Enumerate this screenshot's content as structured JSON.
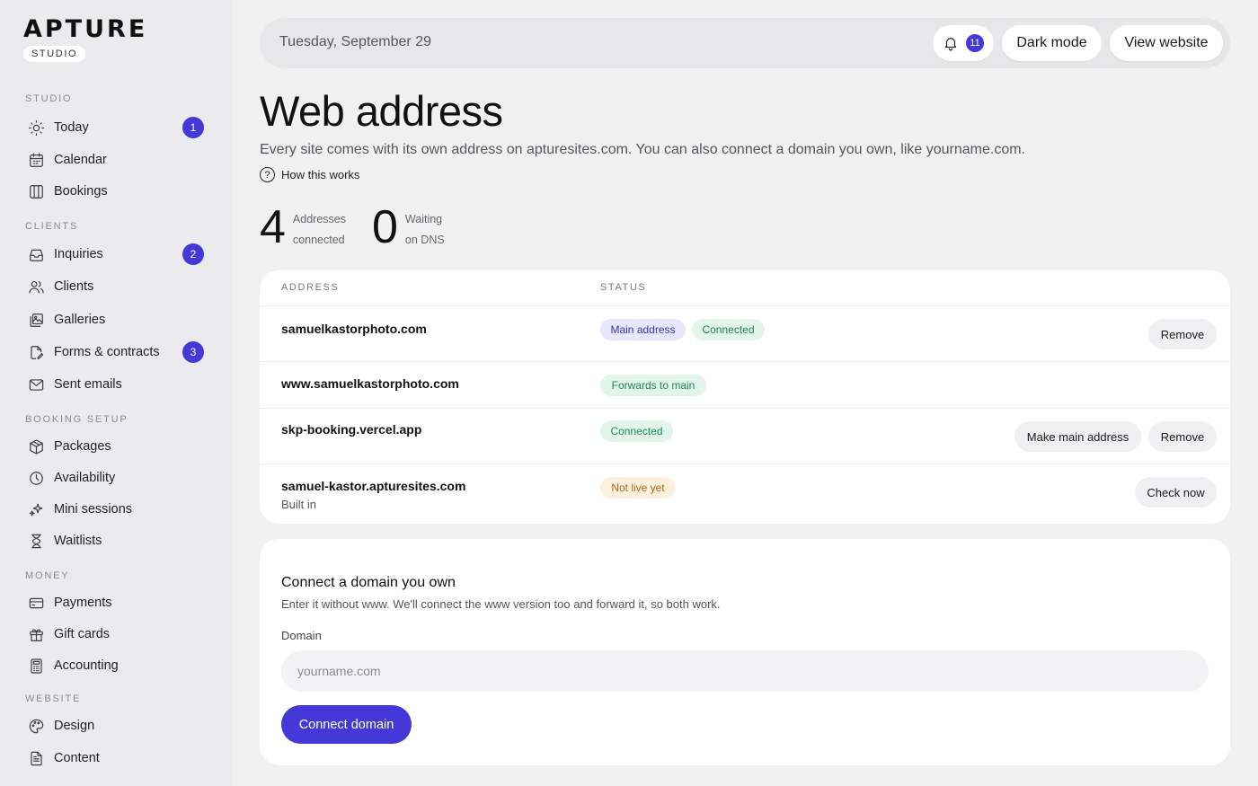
{
  "brand": {
    "logo_text": "APTURE",
    "sub_label": "STUDIO"
  },
  "sidebar": {
    "sections": [
      {
        "id": "studio",
        "label": "STUDIO"
      },
      {
        "id": "clients",
        "label": "CLIENTS"
      },
      {
        "id": "booking",
        "label": "BOOKING SETUP"
      },
      {
        "id": "money",
        "label": "MONEY"
      },
      {
        "id": "website",
        "label": "WEBSITE"
      }
    ],
    "items": [
      {
        "label": "Today",
        "icon": "sun-icon",
        "badge": "1"
      },
      {
        "label": "Calendar",
        "icon": "calendar-icon"
      },
      {
        "label": "Bookings",
        "icon": "columns-icon"
      },
      {
        "label": "Inquiries",
        "icon": "inbox-icon",
        "badge": "2"
      },
      {
        "label": "Clients",
        "icon": "users-icon"
      },
      {
        "label": "Galleries",
        "icon": "gallery-icon"
      },
      {
        "label": "Forms & contracts",
        "icon": "document-edit-icon",
        "badge": "3"
      },
      {
        "label": "Sent emails",
        "icon": "mail-icon"
      },
      {
        "label": "Packages",
        "icon": "package-icon"
      },
      {
        "label": "Availability",
        "icon": "clock-icon"
      },
      {
        "label": "Mini sessions",
        "icon": "sparkle-icon"
      },
      {
        "label": "Waitlists",
        "icon": "hourglass-icon"
      },
      {
        "label": "Payments",
        "icon": "credit-card-icon"
      },
      {
        "label": "Gift cards",
        "icon": "gift-icon"
      },
      {
        "label": "Accounting",
        "icon": "calculator-icon"
      },
      {
        "label": "Design",
        "icon": "palette-icon"
      },
      {
        "label": "Content",
        "icon": "file-text-icon"
      }
    ]
  },
  "topbar": {
    "date": "Tuesday, September 29",
    "notification_count": "11",
    "dark_mode_label": "Dark mode",
    "view_website_label": "View website"
  },
  "page": {
    "title": "Web address",
    "description": "Every site comes with its own address on apturesites.com. You can also connect a domain you own, like yourname.com.",
    "how_link": "How this works",
    "stats": [
      {
        "value": "4",
        "line1": "Addresses",
        "line2": "connected"
      },
      {
        "value": "0",
        "line1": "Waiting",
        "line2": "on DNS"
      }
    ]
  },
  "table": {
    "headers": {
      "address": "ADDRESS",
      "status": "STATUS"
    },
    "rows": [
      {
        "address": "samuelkastorphoto.com",
        "badges": [
          "Main address",
          "Connected"
        ],
        "actions": [
          "Remove"
        ]
      },
      {
        "address": "www.samuelkastorphoto.com",
        "badges": [
          "Forwards to main"
        ],
        "actions": []
      },
      {
        "address": "skp-booking.vercel.app",
        "badges": [
          "Connected"
        ],
        "actions": [
          "Make main address",
          "Remove"
        ]
      },
      {
        "address": "samuel-kastor.apturesites.com",
        "sub": "Built in",
        "badges": [
          "Not live yet"
        ],
        "actions": [
          "Check now"
        ]
      }
    ]
  },
  "connect": {
    "title": "Connect a domain you own",
    "description": "Enter it without www. We'll connect the www version too and forward it, so both work.",
    "field_label": "Domain",
    "placeholder": "yourname.com",
    "value": "",
    "button_label": "Connect domain"
  },
  "colors": {
    "accent": "#4438d9",
    "success": "#1f8a4c",
    "warning": "#b36a12"
  }
}
